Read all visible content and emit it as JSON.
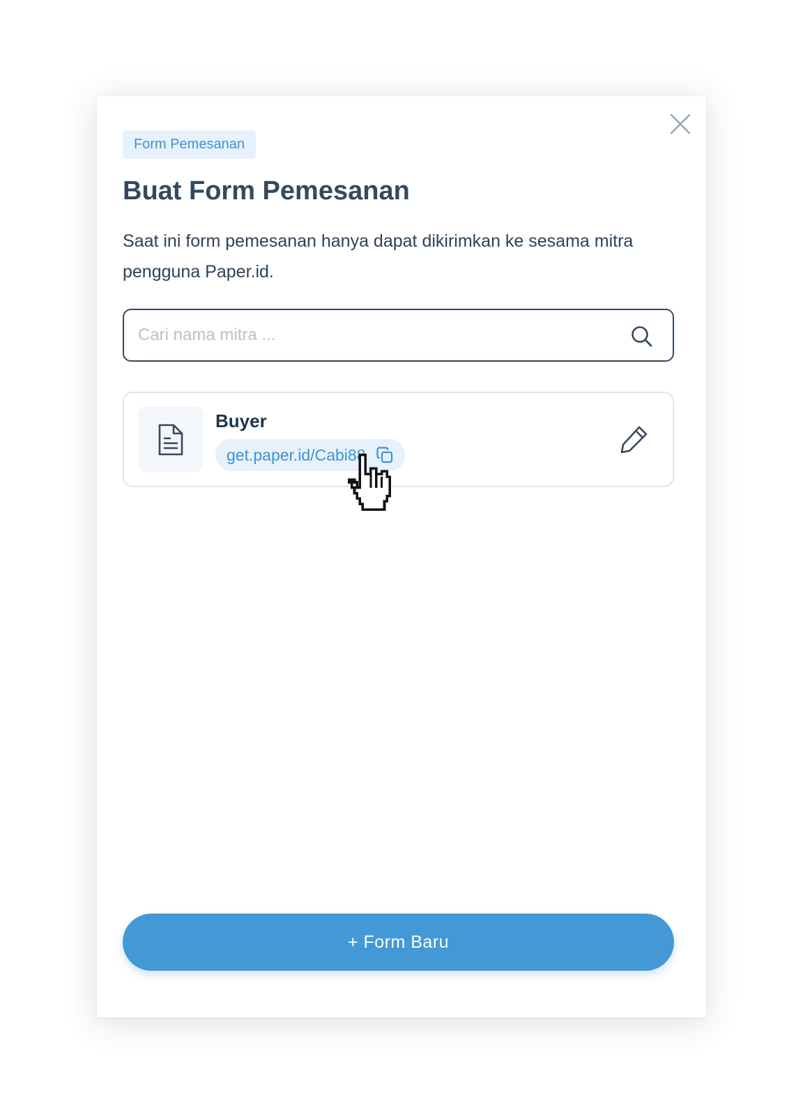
{
  "modal": {
    "tag": "Form Pemesanan",
    "title": "Buat Form Pemesanan",
    "description": "Saat ini form pemesanan hanya dapat dikirimkan ke sesama mitra pengguna Paper.id.",
    "close_icon": "close-icon"
  },
  "search": {
    "placeholder": "Cari nama mitra ...",
    "value": "",
    "icon": "search-icon"
  },
  "forms": [
    {
      "name": "Buyer",
      "link": "get.paper.id/Cabi88",
      "icon": "document-icon",
      "copy_icon": "copy-icon",
      "edit_icon": "pencil-icon"
    }
  ],
  "footer": {
    "new_form_label": "+ Form Baru"
  },
  "colors": {
    "primary": "#4399d6",
    "text_dark": "#34495e",
    "chip_bg": "#e7f1fb",
    "chip_text": "#3f93d0"
  }
}
